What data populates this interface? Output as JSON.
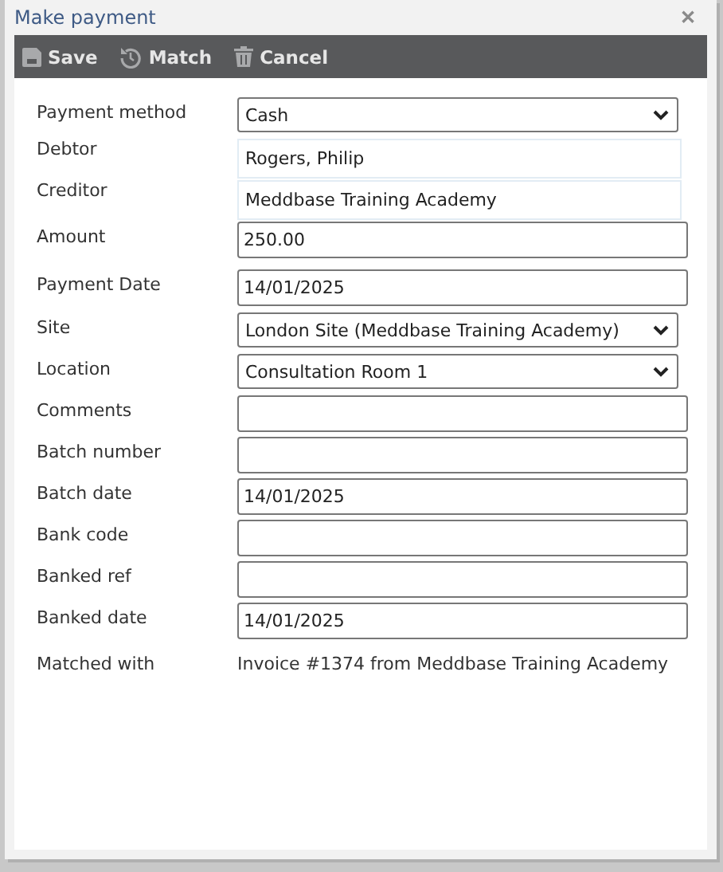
{
  "window": {
    "title": "Make payment",
    "close": "✕"
  },
  "toolbar": [
    {
      "kind": "save",
      "label": "Save"
    },
    {
      "kind": "match",
      "label": "Match"
    },
    {
      "kind": "cancel",
      "label": "Cancel"
    }
  ],
  "fields": [
    {
      "kind": "select",
      "label": "Payment method",
      "value": "Cash"
    },
    {
      "kind": "readonly",
      "label": "Debtor",
      "value": "Rogers, Philip"
    },
    {
      "kind": "readonly",
      "label": "Creditor",
      "value": "Meddbase Training Academy"
    },
    {
      "kind": "input",
      "label": "Amount",
      "value": "250.00"
    },
    {
      "kind": "input",
      "label": "Payment Date",
      "value": "14/01/2025"
    },
    {
      "kind": "select",
      "label": "Site",
      "value": "London Site (Meddbase Training Academy)"
    },
    {
      "kind": "select",
      "label": "Location",
      "value": "Consultation Room 1"
    },
    {
      "kind": "input",
      "label": "Comments"
    },
    {
      "kind": "input",
      "label": "Batch number"
    },
    {
      "kind": "input",
      "label": "Batch date",
      "value": "14/01/2025"
    },
    {
      "kind": "input",
      "label": "Bank code"
    },
    {
      "kind": "input",
      "label": "Banked ref"
    },
    {
      "kind": "input",
      "label": "Banked date",
      "value": "14/01/2025"
    },
    {
      "kind": "text",
      "label": "Matched with",
      "value": "Invoice #1374 from Meddbase Training Academy"
    }
  ]
}
